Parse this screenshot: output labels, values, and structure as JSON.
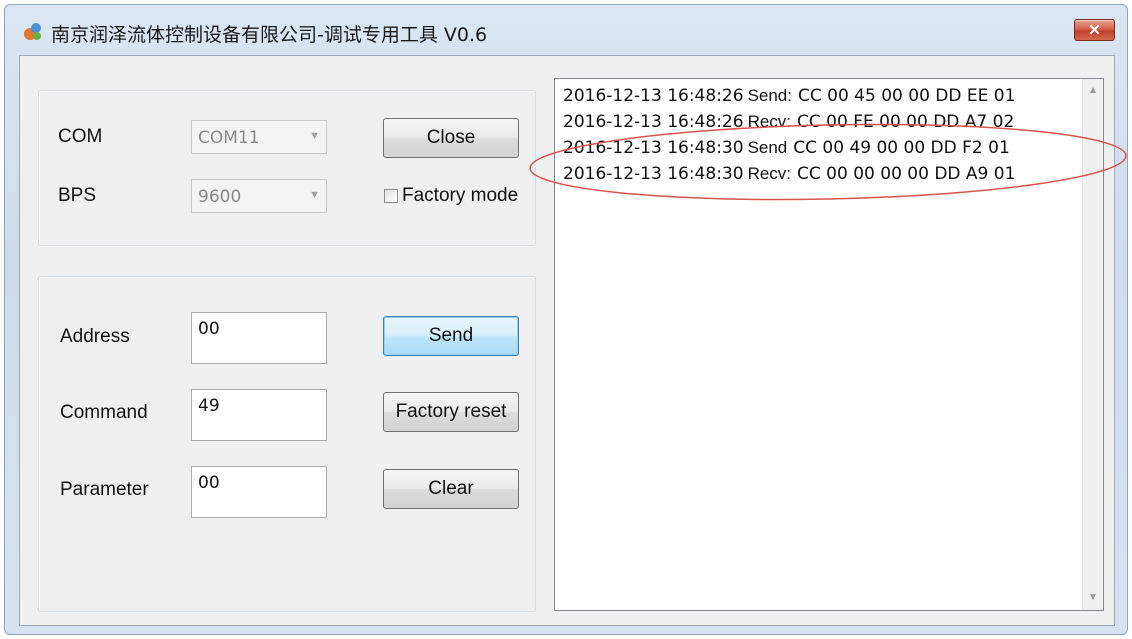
{
  "window": {
    "title": "南京润泽流体控制设备有限公司-调试专用工具 V0.6",
    "close_glyph": "✕",
    "app_icon": "app-icon"
  },
  "connection": {
    "com_label": "COM",
    "com_value": "COM11",
    "bps_label": "BPS",
    "bps_value": "9600",
    "close_button": "Close",
    "factory_mode_label": "Factory mode",
    "factory_mode_checked": false
  },
  "command_panel": {
    "address_label": "Address",
    "address_value": "00",
    "command_label": "Command",
    "command_value": "49",
    "parameter_label": "Parameter",
    "parameter_value": "00",
    "send_button": "Send",
    "factory_reset_button": "Factory reset",
    "clear_button": "Clear"
  },
  "log": {
    "lines": [
      {
        "timestamp": "2016-12-13 16:48:26",
        "direction": "Send:",
        "bytes": "CC 00 45 00 00 DD EE 01"
      },
      {
        "timestamp": "2016-12-13 16:48:26",
        "direction": "Recv:",
        "bytes": "CC 00 FE 00 00 DD A7 02"
      },
      {
        "timestamp": "2016-12-13 16:48:30",
        "direction": "Send",
        "bytes": "CC 00 49 00 00 DD F2 01"
      },
      {
        "timestamp": "2016-12-13 16:48:30",
        "direction": "Recv:",
        "bytes": "CC 00 00 00 00 DD A9 01"
      }
    ]
  },
  "colors": {
    "highlight_ellipse": "#d9534f",
    "default_button_border": "#3c7fb1"
  }
}
